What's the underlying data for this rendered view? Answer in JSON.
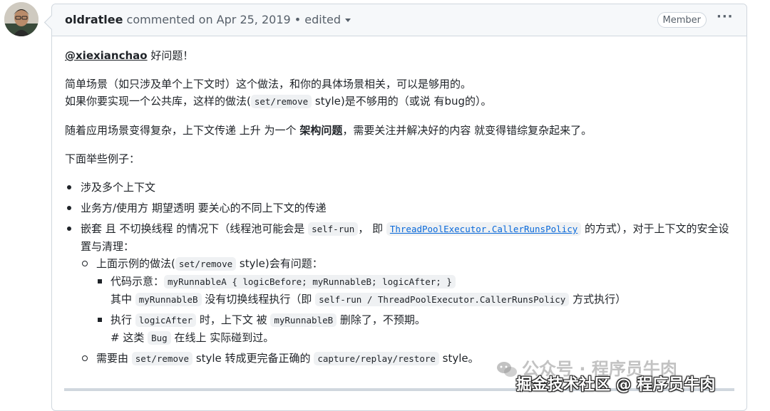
{
  "comment": {
    "author": "oldratlee",
    "action": "commented on",
    "date": "Apr 25, 2019",
    "edited": "• edited",
    "badge": "Member",
    "more": "···"
  },
  "body": {
    "mention": "@xiexianchao",
    "greeting": " 好问题！",
    "p2_line1": "简单场景（如只涉及单个上下文时）这个做法，和你的具体场景相关，可以是够用的。",
    "p2_line2_a": "如果你要实现一个公共库，这样的做法(",
    "p2_line2_code": "set/remove",
    "p2_line2_b": " style)是不够用的（或说 有bug的）。",
    "p3_a": "随着应用场景变得复杂，上下文传递 上升 为一个 ",
    "p3_bold": "架构问题",
    "p3_b": "，需要关注并解决好的内容 就变得错综复杂起来了。",
    "p4": "下面举些例子：",
    "li1": "涉及多个上下文",
    "li2": "业务方/使用方 期望透明 要关心的不同上下文的传递",
    "li3_a": "嵌套 且 不切换线程 的情况下（线程池可能会是 ",
    "li3_code": "self-run",
    "li3_b": "， 即 ",
    "li3_link": "ThreadPoolExecutor.CallerRunsPolicy",
    "li3_c": " 的方式），对于上下文的安全设置与清理：",
    "sub1_a": "上面示例的做法(",
    "sub1_code": "set/remove",
    "sub1_b": " style)会有问题：",
    "s1_a": "代码示意：",
    "s1_code": "myRunnableA {  logicBefore; myRunnableB; logicAfter; }",
    "s1_b": "其中 ",
    "s1_code2": "myRunnableB",
    "s1_c": " 没有切换线程执行（即 ",
    "s1_code3": "self-run / ThreadPoolExecutor.CallerRunsPolicy",
    "s1_d": " 方式执行）",
    "s2_a": "执行 ",
    "s2_code": "logicAfter",
    "s2_b": " 时，上下文 被 ",
    "s2_code2": "myRunnableB",
    "s2_c": " 删除了，不预期。",
    "s2_d": "# 这类 ",
    "s2_code3": "Bug",
    "s2_e": " 在线上 实际碰到过。",
    "sub2_a": "需要由 ",
    "sub2_code": "set/remove",
    "sub2_b": " style 转成更完备正确的 ",
    "sub2_code2": "capture/replay/restore",
    "sub2_c": " style。"
  },
  "watermark": {
    "top": "公众号 · 程序员牛肉",
    "bottom": "掘金技术社区 @ 程序员牛肉"
  },
  "colors": {
    "link": "#0969da",
    "border": "#d0d7de",
    "header_bg": "#f6f8fa"
  }
}
